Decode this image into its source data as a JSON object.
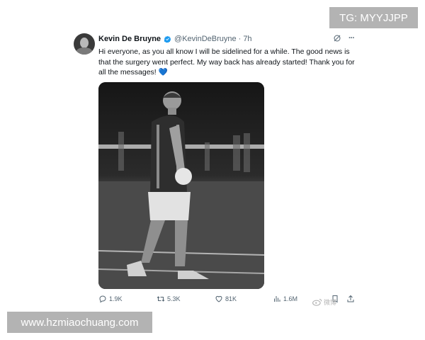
{
  "tweet": {
    "author_name": "Kevin De Bruyne",
    "handle": "@KevinDeBruyne",
    "separator": "·",
    "time": "7h",
    "text": "Hi everyone, as you all know I will be sidelined for a while. The good news is that the surgery went perfect. My way back has already started! Thank you for all the messages!",
    "emoji": "💙",
    "more_icon": "···",
    "grok_icon": "grok-icon"
  },
  "actions": {
    "replies": "1.9K",
    "retweets": "5.3K",
    "likes": "81K",
    "views": "1.6M"
  },
  "watermarks": {
    "tg": "TG: MYYJJPP",
    "url": "www.hzmiaochuang.com",
    "weibo": "微博"
  },
  "colors": {
    "verified": "#1d9bf0",
    "text": "#0f1419",
    "muted": "#536471",
    "watermark_bg": "#b3b3b3"
  }
}
